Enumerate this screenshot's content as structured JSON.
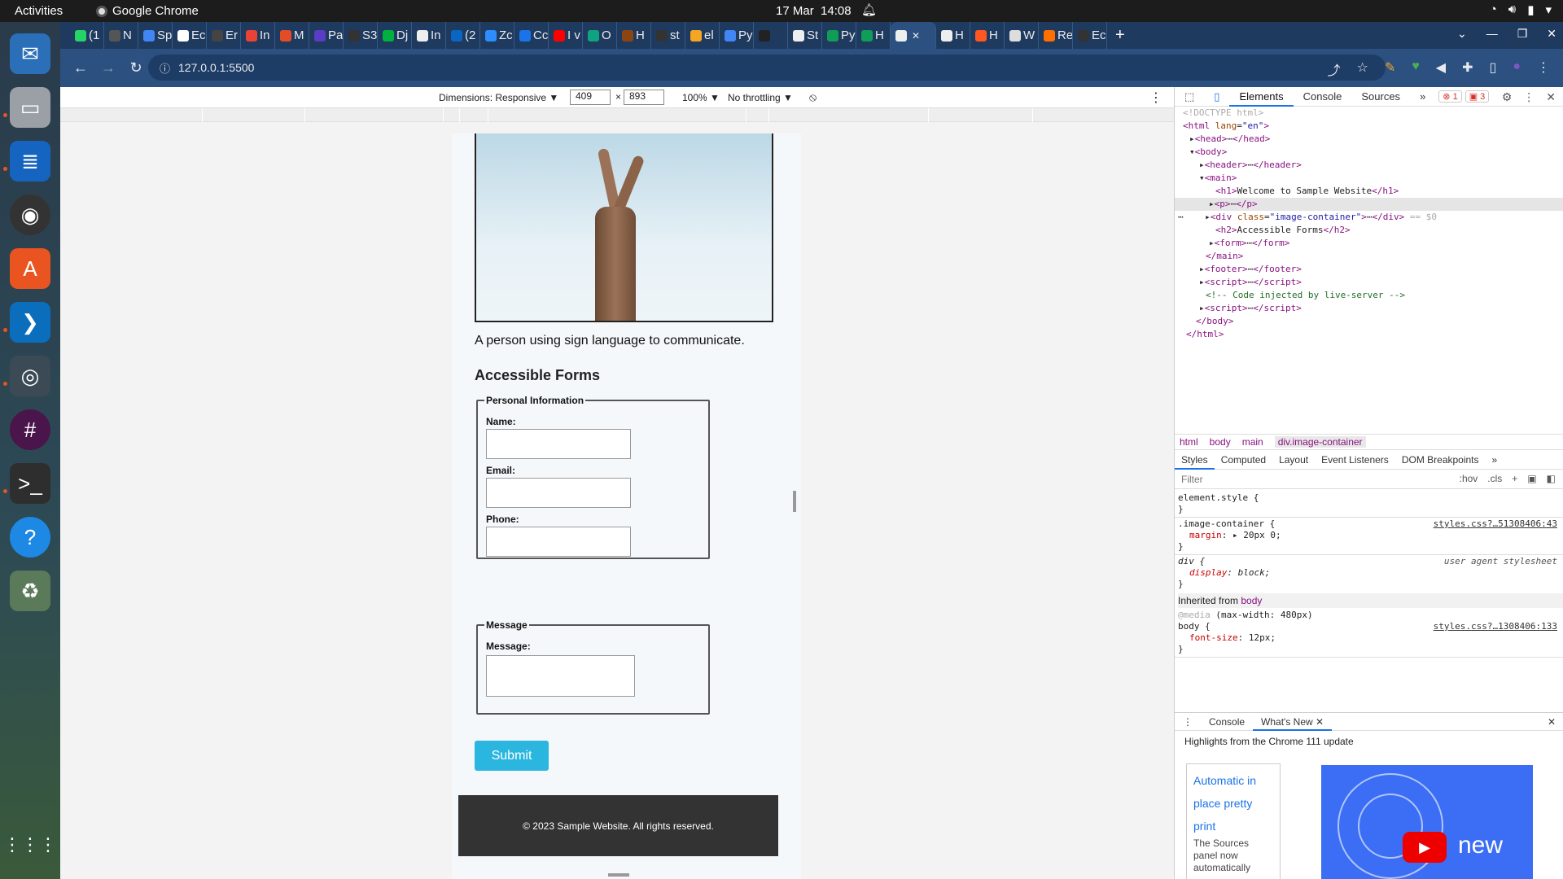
{
  "system_bar": {
    "activities": "Activities",
    "app_name": "Google Chrome",
    "date": "17 Mar",
    "time": "14:08"
  },
  "dock": {
    "items": [
      "thunderbird-icon",
      "files-icon",
      "writer-icon",
      "rhythmbox-icon",
      "software-center-icon",
      "vscode-icon",
      "chrome-icon",
      "slack-icon",
      "terminal-icon",
      "help-icon",
      "trash-icon",
      "app-grid-icon"
    ]
  },
  "browser": {
    "tabs": [
      {
        "label": "(1",
        "color": "#25d366"
      },
      {
        "label": "N",
        "color": "#555555"
      },
      {
        "label": "Sp",
        "color": "#4285f4"
      },
      {
        "label": "Ec",
        "color": "#ffffff"
      },
      {
        "label": "Er",
        "color": "#444444"
      },
      {
        "label": "In",
        "color": "#ea4335"
      },
      {
        "label": "M",
        "color": "#e34c26"
      },
      {
        "label": "Pa",
        "color": "#5b3cc4"
      },
      {
        "label": "S3",
        "color": "#333333"
      },
      {
        "label": "Dj",
        "color": "#00b140"
      },
      {
        "label": "In",
        "color": "#eeeeee"
      },
      {
        "label": "(2",
        "color": "#0a66c2"
      },
      {
        "label": "Zc",
        "color": "#2d8cff"
      },
      {
        "label": "Cc",
        "color": "#1a73e8"
      },
      {
        "label": "I v",
        "color": "#ff0000"
      },
      {
        "label": "O",
        "color": "#10a37f"
      },
      {
        "label": "H",
        "color": "#8b4513"
      },
      {
        "label": "st",
        "color": "#333333"
      },
      {
        "label": "el",
        "color": "#f5a623"
      },
      {
        "label": "Py",
        "color": "#4285f4"
      },
      {
        "label": "",
        "color": "#222222"
      },
      {
        "label": "St",
        "color": "#eeeeee"
      },
      {
        "label": "Py",
        "color": "#0f9d58"
      },
      {
        "label": "H",
        "color": "#0f9d58"
      },
      {
        "label": "",
        "color": "#eeeeee",
        "active": true
      },
      {
        "label": "H",
        "color": "#eeeeee"
      },
      {
        "label": "H",
        "color": "#ff5722"
      },
      {
        "label": "W",
        "color": "#dddddd"
      },
      {
        "label": "Re",
        "color": "#ff6f00"
      },
      {
        "label": "Ec",
        "color": "#333333"
      }
    ],
    "url": "127.0.0.1:5500"
  },
  "device_toolbar": {
    "dimensions_label": "Dimensions: Responsive ▼",
    "width": "409",
    "height": "893",
    "times": "×",
    "zoom": "100% ▼",
    "throttling": "No throttling ▼"
  },
  "site": {
    "caption": "A person using sign language to communicate.",
    "forms_heading": "Accessible Forms",
    "personal_legend": "Personal Information",
    "name_label": "Name:",
    "email_label": "Email:",
    "phone_label": "Phone:",
    "message_legend": "Message",
    "message_label": "Message:",
    "submit_label": "Submit",
    "footer_text": "© 2023 Sample Website. All rights reserved."
  },
  "devtools": {
    "tabs": [
      "Elements",
      "Console",
      "Sources"
    ],
    "more_tabs": "»",
    "errors_badge": "1",
    "warnings_badge": "3",
    "breadcrumbs": [
      "html",
      "body",
      "main",
      "div.image-container"
    ],
    "sub_tabs": [
      "Styles",
      "Computed",
      "Layout",
      "Event Listeners",
      "DOM Breakpoints"
    ],
    "filter_placeholder": "Filter",
    "hov": ":hov",
    "cls": ".cls",
    "drawer_tabs": [
      "Console",
      "What's New"
    ],
    "highlights": "Highlights from the Chrome 111 update",
    "card_title": "Automatic in place pretty print",
    "card_body": "The Sources panel now automatically",
    "video_text": "new"
  }
}
